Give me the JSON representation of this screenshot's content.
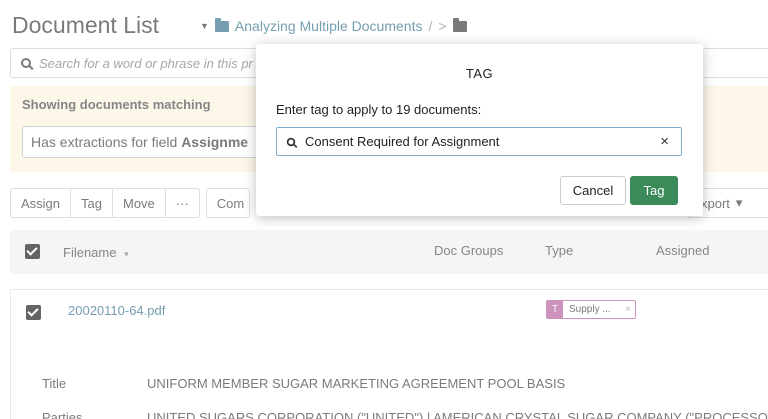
{
  "header": {
    "title": "Document List",
    "breadcrumb": {
      "folder": "Analyzing Multiple Documents",
      "separator": "/",
      "arrow": ">"
    }
  },
  "search": {
    "placeholder": "Search for a word or phrase in this pr"
  },
  "filter": {
    "heading": "Showing documents matching",
    "chip_prefix": "Has extractions for field",
    "chip_field": "Assignme"
  },
  "toolbar": {
    "assign": "Assign",
    "tag": "Tag",
    "move": "Move",
    "more": "···",
    "com": "Com",
    "export": "xport",
    "export_caret": "▾"
  },
  "table": {
    "headers": {
      "filename": "Filename",
      "sort_caret": "▾",
      "doc_groups": "Doc Groups",
      "type": "Type",
      "assigned": "Assigned"
    },
    "row": {
      "filename": "20020110-64.pdf",
      "tag_letter": "T",
      "tag_label": "Supply ...",
      "tag_close": "×",
      "details": [
        {
          "label": "Title",
          "value": "UNIFORM MEMBER SUGAR MARKETING AGREEMENT POOL BASIS"
        },
        {
          "label": "Parties",
          "value": "UNITED SUGARS CORPORATION (\"UNITED\") | AMERICAN CRYSTAL SUGAR COMPANY (\"PROCESSOR\")"
        }
      ]
    }
  },
  "modal": {
    "title": "TAG",
    "prompt": "Enter tag to apply to 19 documents:",
    "input_value": "Consent Required for Assignment",
    "clear": "×",
    "cancel": "Cancel",
    "confirm": "Tag"
  },
  "colors": {
    "accent_green": "#3a8a5a",
    "link_blue": "#2b6b86",
    "tag_purple": "#b25a9a",
    "filter_bg": "#fbf3de"
  }
}
